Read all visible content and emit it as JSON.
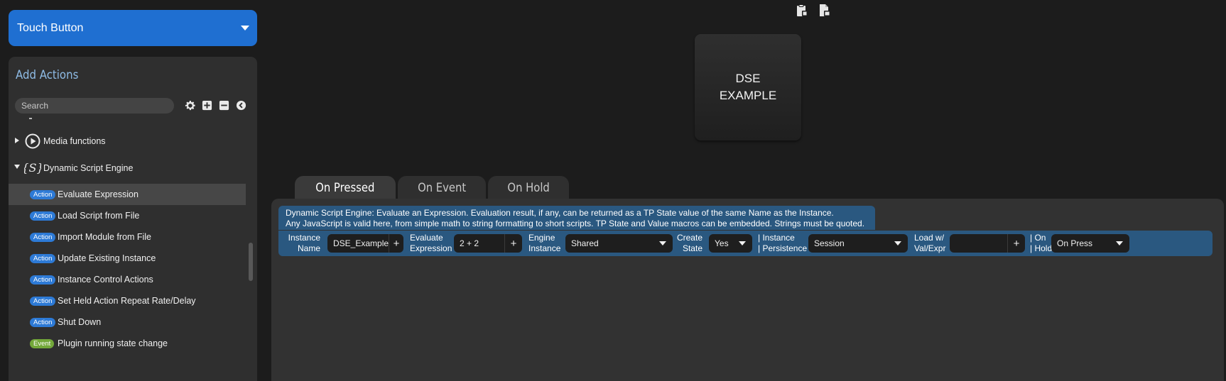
{
  "button_type": {
    "label": "Touch Button"
  },
  "actions_panel": {
    "title": "Add Actions",
    "search_placeholder": "Search",
    "categories": [
      {
        "label": "Media functions",
        "icon": "play-circle-icon",
        "expanded": false
      },
      {
        "label": "Dynamic Script Engine",
        "icon": "script-braces-icon",
        "expanded": true
      }
    ],
    "items": [
      {
        "badge": "Action",
        "label": "Evaluate Expression",
        "selected": true
      },
      {
        "badge": "Action",
        "label": "Load Script from File"
      },
      {
        "badge": "Action",
        "label": "Import Module from File"
      },
      {
        "badge": "Action",
        "label": "Update Existing Instance"
      },
      {
        "badge": "Action",
        "label": "Instance Control Actions"
      },
      {
        "badge": "Action",
        "label": "Set Held Action Repeat Rate/Delay"
      },
      {
        "badge": "Action",
        "label": "Shut Down"
      },
      {
        "badge": "Event",
        "label": "Plugin running state change"
      }
    ]
  },
  "preview": {
    "text": "DSE\nEXAMPLE"
  },
  "tabs": [
    {
      "label": "On Pressed",
      "active": true
    },
    {
      "label": "On Event"
    },
    {
      "label": "On Hold"
    }
  ],
  "description": {
    "line1": "Dynamic Script Engine: Evaluate an Expression. Evaluation result, if any, can be returned as a TP State value of the same Name as the Instance.",
    "line2": "Any JavaScript is valid here, from simple math to string formatting to short scripts. TP State and Value macros can be embedded. Strings must be quoted."
  },
  "params": {
    "instance_name": {
      "label": "Instance\nName",
      "value": "DSE_Example"
    },
    "evaluate_expression": {
      "label": "Evaluate\nExpression",
      "value": "2 + 2"
    },
    "engine_instance": {
      "label": "Engine\nInstance",
      "value": "Shared"
    },
    "create_state": {
      "label": "Create\nState",
      "value": "Yes"
    },
    "instance_persistence": {
      "label": "| Instance\n| Persistence",
      "value": "Session"
    },
    "load_value": {
      "label": "Load w/\nVal/Expr",
      "value": ""
    },
    "on_hold": {
      "label": "| On\n| Hold",
      "value": "On Press"
    },
    "plus_symbol": "+"
  },
  "colors": {
    "accent_blue": "#1f6fd1",
    "param_bar": "#2a5880",
    "action_badge": "#2d7ad6",
    "event_badge": "#73a83a",
    "panel_title": "#8fbce6"
  }
}
